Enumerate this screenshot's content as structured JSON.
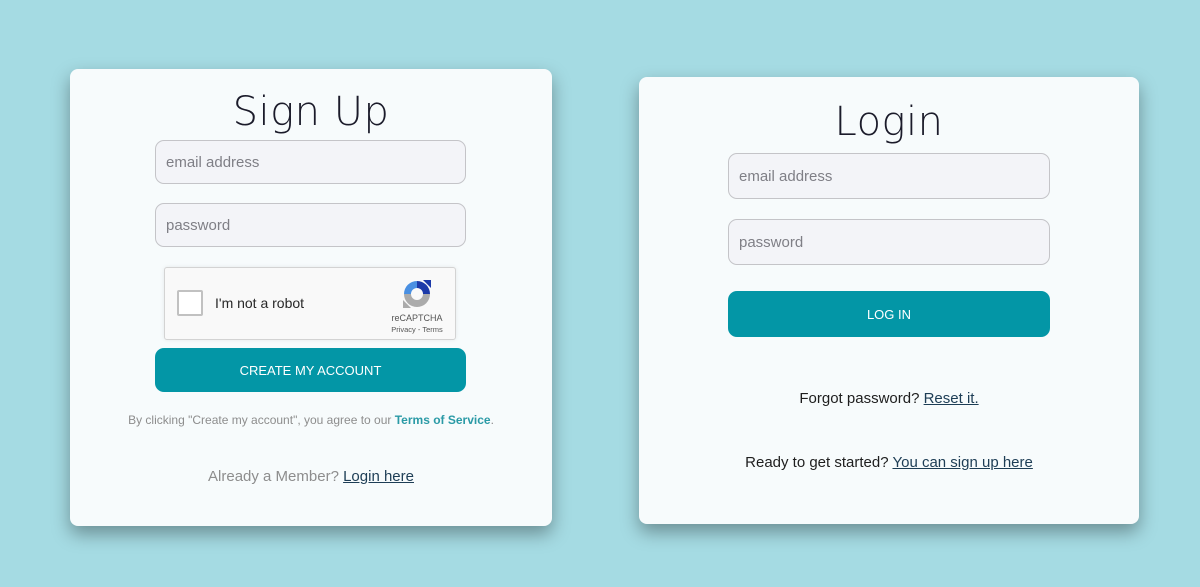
{
  "colors": {
    "background": "#a5dbe3",
    "card": "#f7fbfc",
    "accent": "#0396a6",
    "link": "#1d3d55",
    "tos_link": "#2a9aa6"
  },
  "signup": {
    "title": "Sign Up",
    "email_placeholder": "email address",
    "password_placeholder": "password",
    "captcha": {
      "label": "I'm not a robot",
      "brand": "reCAPTCHA",
      "privacy": "Privacy",
      "separator": " - ",
      "terms": "Terms",
      "icon": "recaptcha-logo"
    },
    "submit_label": "Create my account",
    "agreement_prefix": "By clicking \"Create my account\", you agree to our ",
    "agreement_link": "Terms of Service",
    "agreement_suffix": ".",
    "member_prefix": "Already a Member? ",
    "member_link": "Login here"
  },
  "login": {
    "title": "Login",
    "email_placeholder": "email address",
    "password_placeholder": "password",
    "submit_label": "Log in",
    "forgot_prefix": "Forgot password? ",
    "forgot_link": "Reset it.",
    "signup_prefix": "Ready to get started? ",
    "signup_link": "You can sign up here"
  }
}
